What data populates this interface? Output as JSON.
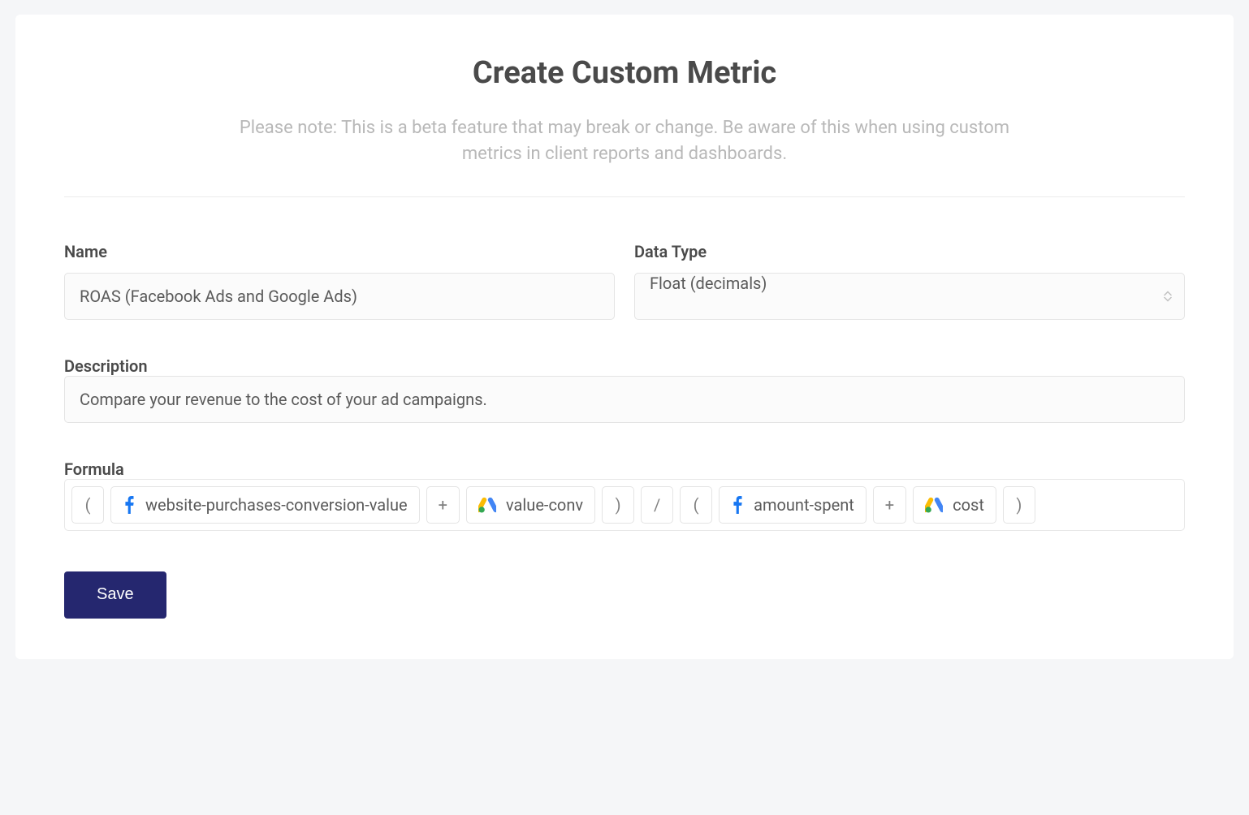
{
  "header": {
    "title": "Create Custom Metric",
    "subtitle": "Please note: This is a beta feature that may break or change. Be aware of this when using custom metrics in client reports and dashboards."
  },
  "fields": {
    "name": {
      "label": "Name",
      "value": "ROAS (Facebook Ads and Google Ads)"
    },
    "dataType": {
      "label": "Data Type",
      "value": "Float (decimals)"
    },
    "description": {
      "label": "Description",
      "value": "Compare your revenue to the cost of your ad campaigns."
    },
    "formula": {
      "label": "Formula",
      "tokens": {
        "paren_open_1": "(",
        "fb_metric_1": "website-purchases-conversion-value",
        "plus_1": "+",
        "gads_metric_1": "value-conv",
        "paren_close_1": ")",
        "divide": "/",
        "paren_open_2": "(",
        "fb_metric_2": "amount-spent",
        "plus_2": "+",
        "gads_metric_2": "cost",
        "paren_close_2": ")"
      }
    }
  },
  "icons": {
    "facebook": "facebook-icon",
    "googleAds": "google-ads-icon"
  },
  "actions": {
    "save": "Save"
  }
}
